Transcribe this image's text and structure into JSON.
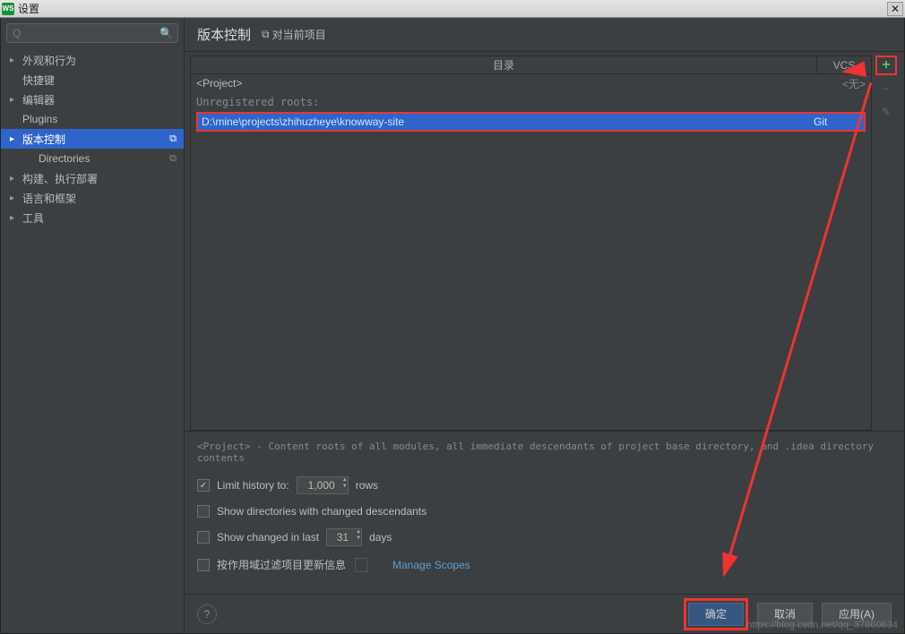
{
  "window": {
    "logo": "WS",
    "title": "设置"
  },
  "sidebar": {
    "search_placeholder": "Q",
    "items": [
      {
        "label": "外观和行为",
        "arrow": "▸",
        "indent": false
      },
      {
        "label": "快捷键",
        "arrow": "",
        "indent": false
      },
      {
        "label": "编辑器",
        "arrow": "▸",
        "indent": false
      },
      {
        "label": "Plugins",
        "arrow": "",
        "indent": false
      },
      {
        "label": "版本控制",
        "arrow": "▸",
        "indent": false,
        "selected": true,
        "badge": "⧉"
      },
      {
        "label": "Directories",
        "arrow": "",
        "indent": true,
        "badge": "⧉"
      },
      {
        "label": "构建、执行部署",
        "arrow": "▸",
        "indent": false
      },
      {
        "label": "语言和框架",
        "arrow": "▸",
        "indent": false
      },
      {
        "label": "工具",
        "arrow": "▸",
        "indent": false
      }
    ]
  },
  "main": {
    "title": "版本控制",
    "scope_label": "对当前项目",
    "table": {
      "col_dir": "目录",
      "col_vcs": "VCS",
      "project_row": {
        "dir": "<Project>",
        "vcs": "<无>"
      },
      "unregistered_label": "Unregistered roots:",
      "selected_row": {
        "path": "D:\\mine\\projects\\zhihuzheye\\knowway-site",
        "vcs": "Git"
      }
    },
    "side_buttons": {
      "add": "+",
      "remove": "−",
      "edit": "✎"
    },
    "desc": "<Project> - Content roots of all modules, all immediate descendants of project base directory, and .idea directory contents",
    "options": {
      "limit_history": {
        "checked": true,
        "label": "Limit history to:",
        "value": "1,000",
        "suffix": "rows"
      },
      "show_dirs": {
        "checked": false,
        "label": "Show directories with changed descendants"
      },
      "show_changed": {
        "checked": false,
        "label": "Show changed in last",
        "value": "31",
        "suffix": "days"
      },
      "filter_scope": {
        "checked": false,
        "label": "按作用域过滤项目更新信息",
        "link": "Manage Scopes"
      }
    }
  },
  "footer": {
    "ok": "确定",
    "cancel": "取消",
    "apply": "应用(A)"
  },
  "watermark": "https://blog.csdn.net/qq_37860634"
}
